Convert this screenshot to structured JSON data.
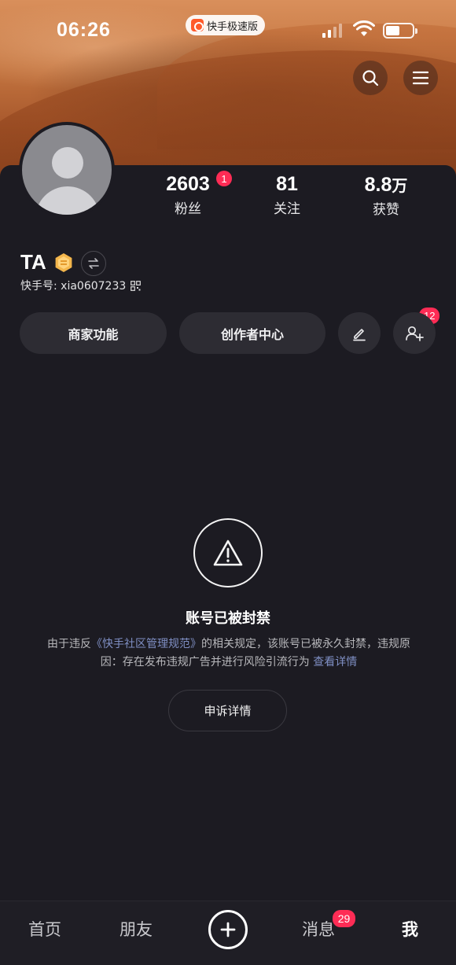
{
  "status_bar": {
    "time": "06:26",
    "app_indicator": "快手极速版"
  },
  "profile": {
    "name": "TA",
    "uid": "快手号: xia0607233",
    "stats": [
      {
        "value": "2603",
        "unit": "",
        "label": "粉丝",
        "badge": "1"
      },
      {
        "value": "81",
        "unit": "",
        "label": "关注"
      },
      {
        "value": "8.8",
        "unit": "万",
        "label": "获赞"
      }
    ]
  },
  "actions": {
    "merchant_label": "商家功能",
    "creator_label": "创作者中心",
    "add_friend_badge": "12"
  },
  "ban_notice": {
    "title": "账号已被封禁",
    "desc_prefix": "由于违反",
    "guideline_link": "《快手社区管理规范》",
    "desc_suffix": "的相关规定，该账号已被永久封禁，违规原因：存在发布违规广告并进行风险引流行为",
    "details_link": "查看详情",
    "appeal_label": "申诉详情"
  },
  "tabbar": {
    "items": [
      "首页",
      "朋友",
      "消息",
      "我"
    ],
    "messages_badge": "29"
  },
  "colors": {
    "background": "#1c1b22",
    "badge": "#fe2c55",
    "link": "#7f8fc4"
  }
}
